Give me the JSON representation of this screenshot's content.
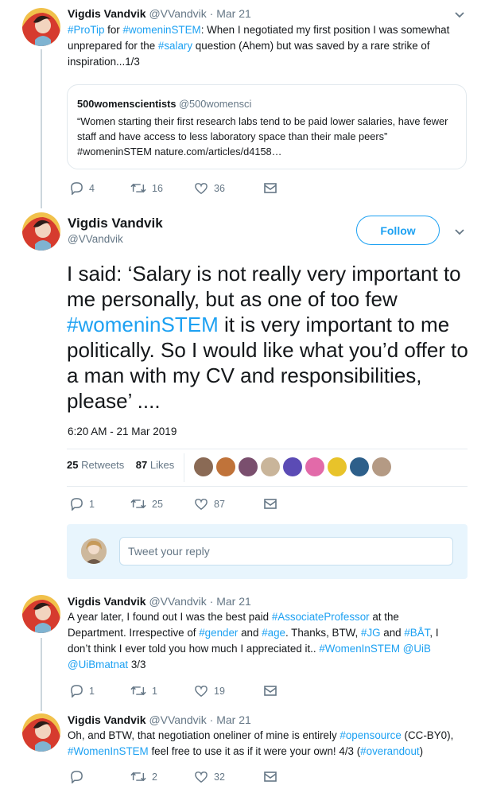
{
  "tweet1": {
    "name": "Vigdis Vandvik",
    "handle": "@VVandvik",
    "dot": "·",
    "date": "Mar 21",
    "text": [
      {
        "t": "#ProTip",
        "link": true
      },
      {
        "t": " for ",
        "link": false
      },
      {
        "t": "#womeninSTEM",
        "link": true
      },
      {
        "t": ": When I negotiated my first position I was somewhat unprepared for the ",
        "link": false
      },
      {
        "t": "#salary",
        "link": true
      },
      {
        "t": " question (Ahem) but was saved by a rare strike of inspiration...1/3",
        "link": false
      }
    ],
    "quote": {
      "name": "500womenscientists",
      "handle": "@500womensci",
      "text": "“Women starting their first research labs tend to be paid lower salaries, have fewer staff and have access to less laboratory space than their male peers” #womeninSTEM nature.com/articles/d4158…"
    },
    "replies": "4",
    "retweets": "16",
    "likes": "36"
  },
  "main": {
    "name": "Vigdis Vandvik",
    "handle": "@VVandvik",
    "follow_label": "Follow",
    "text": [
      {
        "t": "I said: ‘Salary is not really very important to me personally, but as one of too few ",
        "link": false
      },
      {
        "t": "#womeninSTEM",
        "link": true
      },
      {
        "t": " it is very important to me politically. So I would like what you’d offer to a man with my CV and responsibilities, please’ ....",
        "link": false
      }
    ],
    "timestamp": "6:20 AM - 21 Mar 2019",
    "retweets_count": "25",
    "retweets_label": "Retweets",
    "likes_count": "87",
    "likes_label": "Likes",
    "likers_colors": [
      "#8a6a55",
      "#c0733a",
      "#7a4f6e",
      "#c9b59a",
      "#5b4bb5",
      "#e26aa9",
      "#e8c32a",
      "#2d5f8a",
      "#b49a84"
    ],
    "replies": "1",
    "retweets": "25",
    "likes": "87"
  },
  "reply": {
    "placeholder": "Tweet your reply"
  },
  "tweet3": {
    "name": "Vigdis Vandvik",
    "handle": "@VVandvik",
    "dot": "·",
    "date": "Mar 21",
    "text": [
      {
        "t": "A year later, I found out I was the best paid ",
        "link": false
      },
      {
        "t": "#AssociateProfessor",
        "link": true
      },
      {
        "t": " at the Department. Irrespective of ",
        "link": false
      },
      {
        "t": "#gender",
        "link": true
      },
      {
        "t": " and ",
        "link": false
      },
      {
        "t": "#age",
        "link": true
      },
      {
        "t": ". Thanks, BTW, ",
        "link": false
      },
      {
        "t": "#JG",
        "link": true
      },
      {
        "t": " and ",
        "link": false
      },
      {
        "t": "#BÅT",
        "link": true
      },
      {
        "t": ", I don’t think I ever told you how much I appreciated it.. ",
        "link": false
      },
      {
        "t": "#WomenInSTEM",
        "link": true
      },
      {
        "t": " ",
        "link": false
      },
      {
        "t": "@UiB",
        "link": true
      },
      {
        "t": " ",
        "link": false
      },
      {
        "t": "@UiBmatnat",
        "link": true
      },
      {
        "t": " 3/3",
        "link": false
      }
    ],
    "replies": "1",
    "retweets": "1",
    "likes": "19"
  },
  "tweet4": {
    "name": "Vigdis Vandvik",
    "handle": "@VVandvik",
    "dot": "·",
    "date": "Mar 21",
    "text": [
      {
        "t": "Oh, and BTW, that negotiation oneliner of mine is entirely ",
        "link": false
      },
      {
        "t": "#opensource",
        "link": true
      },
      {
        "t": " (CC-BY0), ",
        "link": false
      },
      {
        "t": "#WomenInSTEM",
        "link": true
      },
      {
        "t": " feel free to use it as if it were your own! 4/3 (",
        "link": false
      },
      {
        "t": "#overandout",
        "link": true
      },
      {
        "t": ")",
        "link": false
      }
    ],
    "replies": "",
    "retweets": "2",
    "likes": "32"
  }
}
